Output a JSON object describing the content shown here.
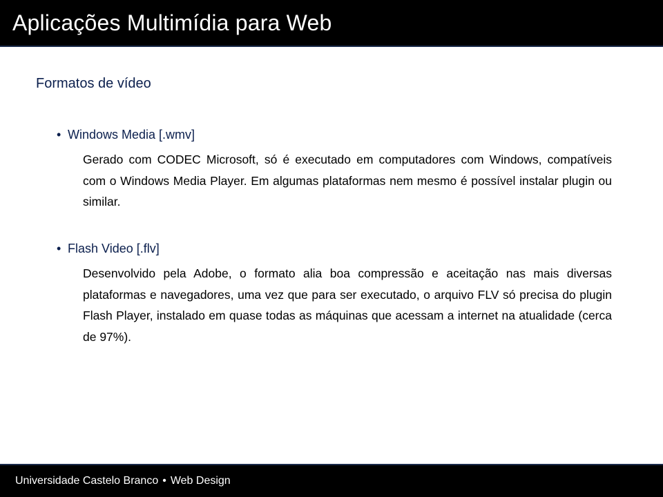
{
  "header": {
    "title": "Aplicações Multimídia para Web"
  },
  "section": {
    "title": "Formatos de vídeo"
  },
  "items": [
    {
      "name": "Windows Media [.wmv]",
      "desc": "Gerado com CODEC Microsoft, só é executado em computadores com Windows, compatíveis com o Windows Media Player. Em algumas plataformas nem mesmo é possível instalar plugin ou similar."
    },
    {
      "name": "Flash Video [.flv]",
      "desc": "Desenvolvido pela Adobe, o formato alia boa compressão e aceitação nas mais diversas plataformas e navegadores, uma vez que para ser executado, o arquivo FLV só precisa do plugin Flash Player, instalado em quase todas as máquinas que acessam a internet na atualidade (cerca de 97%)."
    }
  ],
  "footer": {
    "university": "Universidade Castelo Branco",
    "separator": "•",
    "course": "Web Design"
  }
}
